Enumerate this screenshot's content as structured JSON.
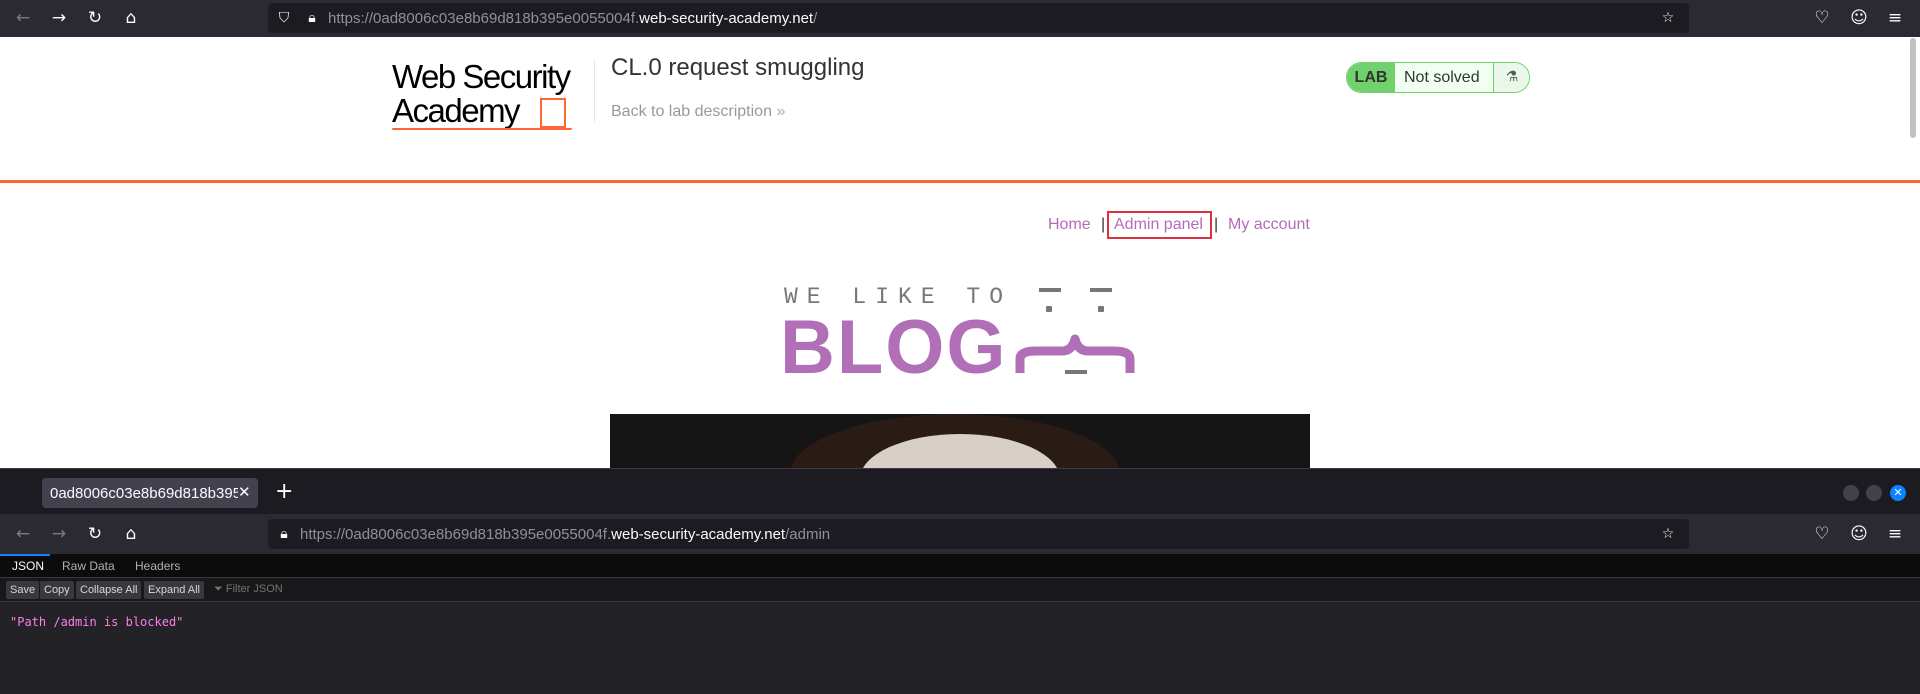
{
  "top_browser": {
    "url_prefix": "https://0ad8006c03e8b69d818b395e0055004f.",
    "url_host": "web-security-academy.net",
    "url_path": "/"
  },
  "lab_header": {
    "logo_line1": "Web Security",
    "logo_line2": "Academy",
    "title": "CL.0 request smuggling",
    "back_link": "Back to lab description",
    "back_link_glyph": "»",
    "badge_tag": "LAB",
    "status": "Not solved"
  },
  "blog_nav": {
    "home": "Home",
    "admin_panel": "Admin panel",
    "my_account": "My account",
    "separator": "|"
  },
  "banner": {
    "tagline": "WE LIKE TO",
    "word": "BLOG"
  },
  "second_window": {
    "tab_title": "0ad8006c03e8b69d818b395",
    "url_prefix": "https://0ad8006c03e8b69d818b395e0055004f.",
    "url_host": "web-security-academy.net",
    "url_path": "/admin",
    "viewer_tabs": [
      "JSON",
      "Raw Data",
      "Headers"
    ],
    "viewer_buttons": [
      "Save",
      "Copy",
      "Collapse All",
      "Expand All"
    ],
    "filter_placeholder": "Filter JSON",
    "json_value": "\"Path /admin is blocked\""
  },
  "colors": {
    "accent_orange": "#ff6633",
    "blog_purple": "#b16fb8",
    "lab_green": "#70d16d",
    "highlight_red": "#e0303f",
    "json_string_pink": "#ff7de9"
  },
  "icons": [
    "back-icon",
    "forward-icon",
    "reload-icon",
    "home-icon",
    "shield-icon",
    "lock-icon",
    "star-icon",
    "pocket-icon",
    "profile-icon",
    "menu-icon",
    "flask-icon",
    "close-icon",
    "plus-icon",
    "filter-icon"
  ]
}
